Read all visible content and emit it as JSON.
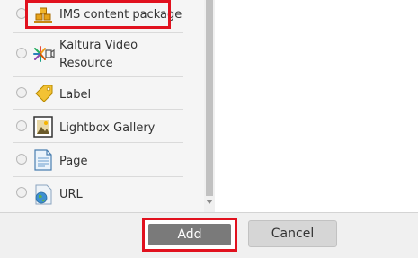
{
  "activities": [
    {
      "label": "IMS content package",
      "icon": "ims-package-icon"
    },
    {
      "label_line1": "Kaltura Video",
      "label_line2": "Resource",
      "icon": "kaltura-video-icon"
    },
    {
      "label": "Label",
      "icon": "label-tag-icon"
    },
    {
      "label": "Lightbox Gallery",
      "icon": "lightbox-gallery-icon"
    },
    {
      "label": "Page",
      "icon": "page-icon"
    },
    {
      "label": "URL",
      "icon": "url-globe-icon"
    }
  ],
  "footer": {
    "add_label": "Add",
    "cancel_label": "Cancel"
  },
  "colors": {
    "highlight": "#e1111e",
    "add_button": "#7a7a7a",
    "cancel_button": "#d6d6d6"
  }
}
